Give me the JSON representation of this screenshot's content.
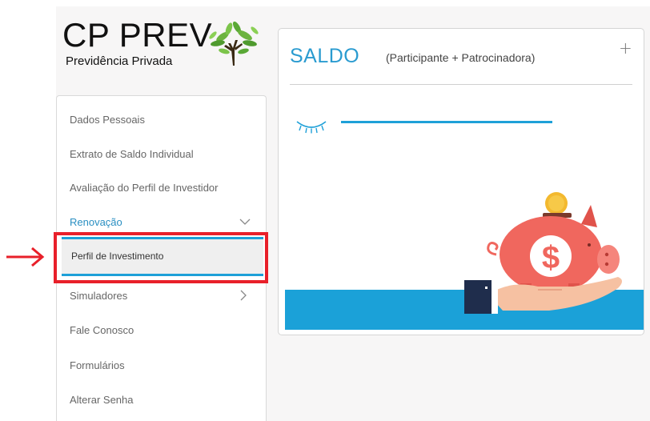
{
  "logo": {
    "title": "CP PREV",
    "subtitle": "Previdência Privada"
  },
  "sidebar": {
    "items": [
      {
        "label": "Dados Pessoais"
      },
      {
        "label": "Extrato de Saldo Individual"
      },
      {
        "label": "Avaliação do Perfil de Investidor"
      },
      {
        "label": "Renovação",
        "expanded": true,
        "active": true
      },
      {
        "label": "Simuladores",
        "has_children": true
      },
      {
        "label": "Fale Conosco"
      },
      {
        "label": "Formulários"
      },
      {
        "label": "Alterar Senha"
      }
    ],
    "submenu": {
      "label": "Perfil de Investimento"
    }
  },
  "card": {
    "title": "SALDO",
    "subtitle": "(Participante + Patrocinadora)",
    "plus": "+"
  },
  "colors": {
    "accent": "#1ea0d8",
    "highlight": "#e8202a",
    "pig": "#f0675e"
  }
}
